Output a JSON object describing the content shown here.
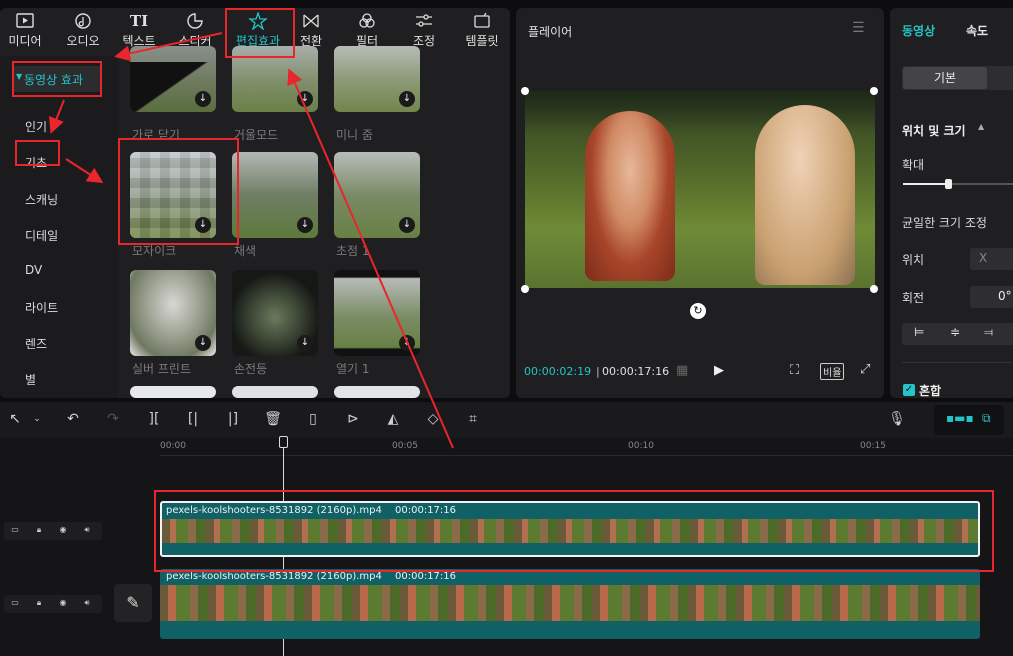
{
  "top_tabs": [
    {
      "label": "미디어",
      "icon": "media-icon"
    },
    {
      "label": "오디오",
      "icon": "audio-icon"
    },
    {
      "label": "텍스트",
      "icon": "text-icon"
    },
    {
      "label": "스티커",
      "icon": "sticker-icon"
    },
    {
      "label": "편집효과",
      "icon": "effects-icon",
      "active": true
    },
    {
      "label": "전환",
      "icon": "transition-icon"
    },
    {
      "label": "필터",
      "icon": "filter-icon"
    },
    {
      "label": "조정",
      "icon": "adjust-icon"
    },
    {
      "label": "템플릿",
      "icon": "template-icon"
    }
  ],
  "categories": {
    "header": "동영상 효과",
    "items": [
      "인기",
      "기초",
      "스캐닝",
      "디테일",
      "DV",
      "라이트",
      "렌즈",
      "별"
    ]
  },
  "effects": [
    "가로 닫기",
    "거울모드",
    "미니 줌",
    "모자이크",
    "채색",
    "초점 1",
    "실버 프린트",
    "손전등",
    "열기 1"
  ],
  "player": {
    "title": "플레이어",
    "current_time": "00:00:02:19",
    "total_time": "00:00:17:16",
    "ratio_label": "비율"
  },
  "props": {
    "tabs": [
      "동영상",
      "속도"
    ],
    "subtab": "기본",
    "section": "위치 및 크기",
    "scale_label": "확대",
    "uniform_label": "균일한 크기 조정",
    "position_label": "위치",
    "position_x": "X",
    "rotate_label": "회전",
    "rotate_value": "0°",
    "blend_label": "혼합"
  },
  "ruler": [
    "00:00",
    "00:05",
    "00:10",
    "00:15"
  ],
  "clips": [
    {
      "name": "pexels-koolshooters-8531892 (2160p).mp4",
      "duration": "00:00:17:16"
    },
    {
      "name": "pexels-koolshooters-8531892 (2160p).mp4",
      "duration": "00:00:17:16"
    }
  ],
  "colors": {
    "accent": "#24c4c8",
    "annot": "#e8262b",
    "clip": "#0f6166"
  }
}
